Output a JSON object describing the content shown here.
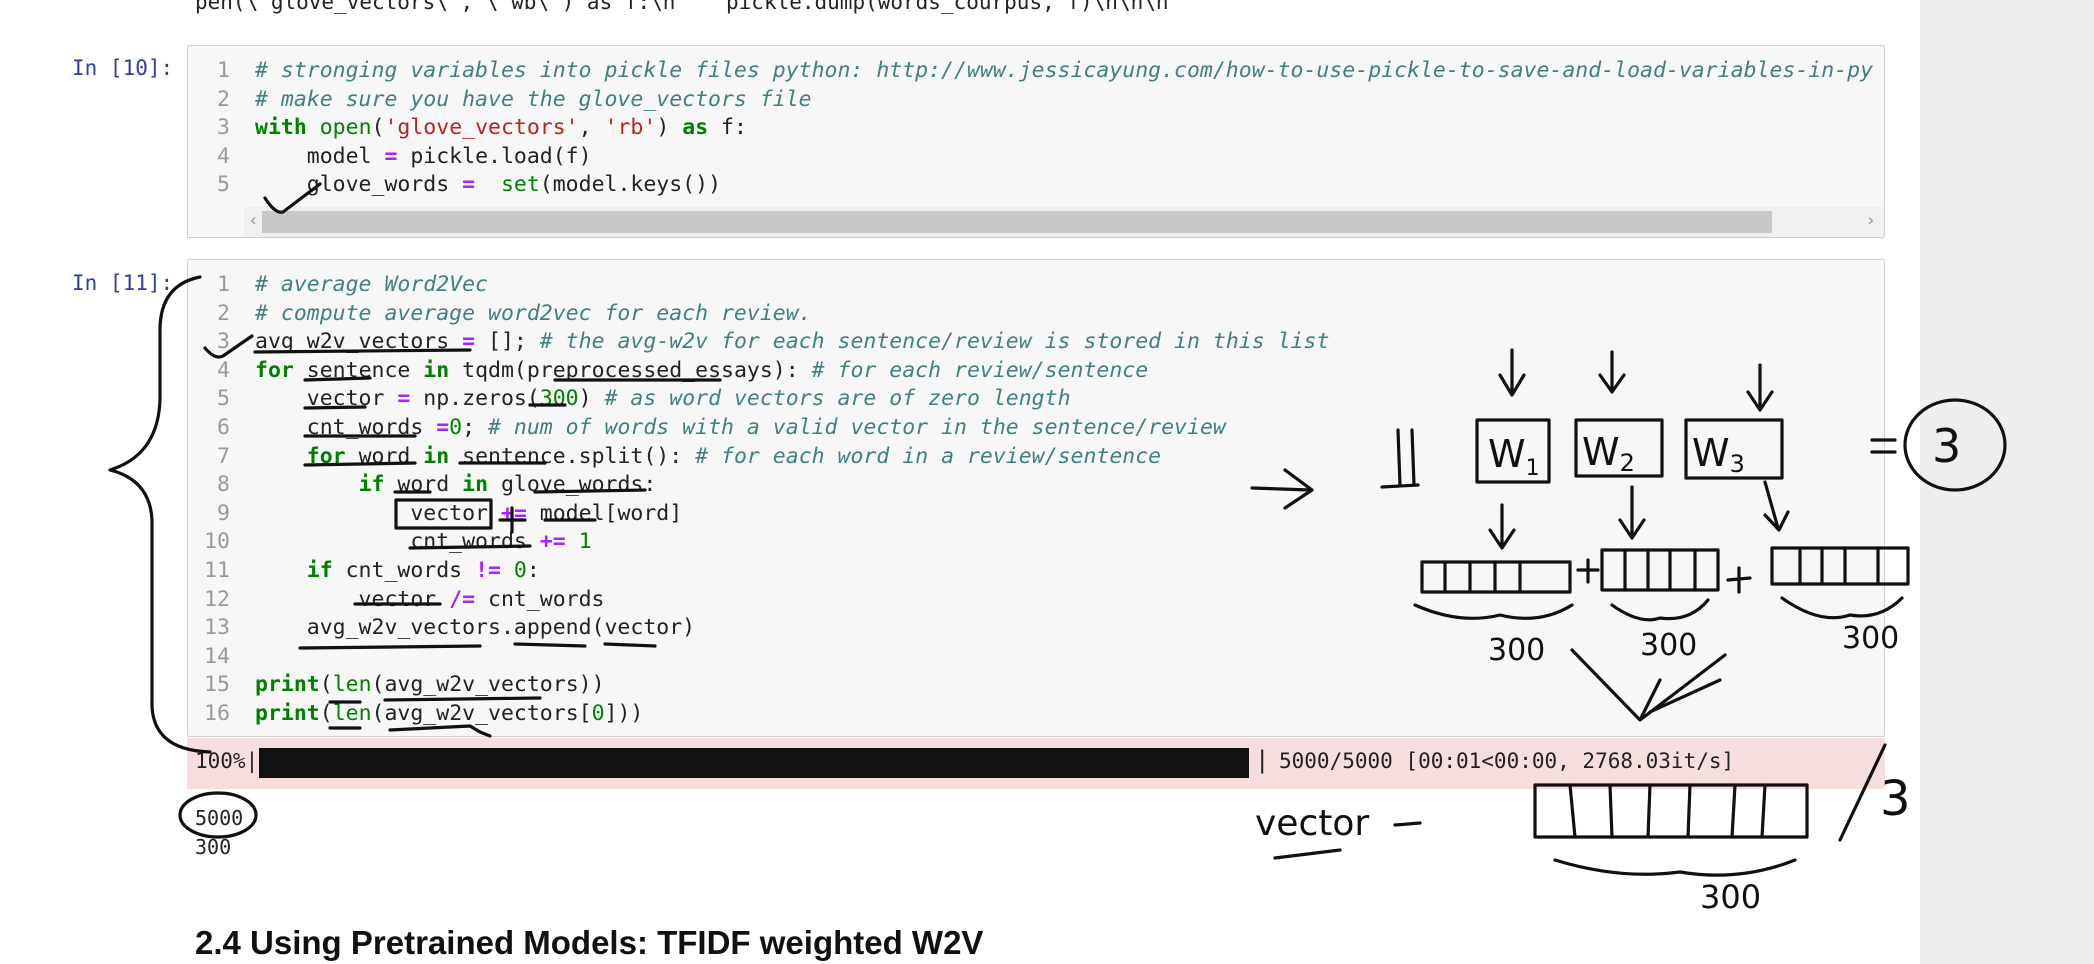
{
  "top_fragment": "pen(\\'glove_vectors\\', \\'wb\\') as f:\\n    pickle.dump(words_courpus, f)\\n\\n\\n",
  "cells": [
    {
      "prompt": "In [10]:",
      "lines": [
        [
          [
            "cm",
            "# stronging variables into pickle files python: http://www.jessicayung.com/how-to-use-pickle-to-save-and-load-variables-in-py"
          ]
        ],
        [
          [
            "cm",
            "# make sure you have the glove_vectors file"
          ]
        ],
        [
          [
            "kw",
            "with"
          ],
          [
            "tx",
            " "
          ],
          [
            "bi",
            "open"
          ],
          [
            "tx",
            "("
          ],
          [
            "st",
            "'glove_vectors'"
          ],
          [
            "tx",
            ", "
          ],
          [
            "st",
            "'rb'"
          ],
          [
            "tx",
            ") "
          ],
          [
            "kw",
            "as"
          ],
          [
            "tx",
            " f:"
          ]
        ],
        [
          [
            "tx",
            "    model "
          ],
          [
            "op",
            "="
          ],
          [
            "tx",
            " pickle.load(f)"
          ]
        ],
        [
          [
            "tx",
            "    glove_words "
          ],
          [
            "op",
            "="
          ],
          [
            "tx",
            "  "
          ],
          [
            "bi",
            "set"
          ],
          [
            "tx",
            "(model.keys())"
          ]
        ]
      ]
    },
    {
      "prompt": "In [11]:",
      "lines": [
        [
          [
            "cm",
            "# average Word2Vec"
          ]
        ],
        [
          [
            "cm",
            "# compute average word2vec for each review."
          ]
        ],
        [
          [
            "tx",
            "avg_w2v_vectors "
          ],
          [
            "op",
            "="
          ],
          [
            "tx",
            " []; "
          ],
          [
            "cm",
            "# the avg-w2v for each sentence/review is stored in this list"
          ]
        ],
        [
          [
            "kw",
            "for"
          ],
          [
            "tx",
            " sentence "
          ],
          [
            "kw",
            "in"
          ],
          [
            "tx",
            " tqdm(preprocessed_essays): "
          ],
          [
            "cm",
            "# for each review/sentence"
          ]
        ],
        [
          [
            "tx",
            "    vector "
          ],
          [
            "op",
            "="
          ],
          [
            "tx",
            " np.zeros("
          ],
          [
            "nm",
            "300"
          ],
          [
            "tx",
            ") "
          ],
          [
            "cm",
            "# as word vectors are of zero length"
          ]
        ],
        [
          [
            "tx",
            "    cnt_words "
          ],
          [
            "op",
            "="
          ],
          [
            "nm",
            "0"
          ],
          [
            "tx",
            "; "
          ],
          [
            "cm",
            "# num of words with a valid vector in the sentence/review"
          ]
        ],
        [
          [
            "tx",
            "    "
          ],
          [
            "kw",
            "for"
          ],
          [
            "tx",
            " word "
          ],
          [
            "kw",
            "in"
          ],
          [
            "tx",
            " sentence.split(): "
          ],
          [
            "cm",
            "# for each word in a review/sentence"
          ]
        ],
        [
          [
            "tx",
            "        "
          ],
          [
            "kw",
            "if"
          ],
          [
            "tx",
            " word "
          ],
          [
            "kw",
            "in"
          ],
          [
            "tx",
            " glove_words:"
          ]
        ],
        [
          [
            "tx",
            "            vector "
          ],
          [
            "op",
            "+="
          ],
          [
            "tx",
            " model[word]"
          ]
        ],
        [
          [
            "tx",
            "            cnt_words "
          ],
          [
            "op",
            "+="
          ],
          [
            "tx",
            " "
          ],
          [
            "nm",
            "1"
          ]
        ],
        [
          [
            "tx",
            "    "
          ],
          [
            "kw",
            "if"
          ],
          [
            "tx",
            " cnt_words "
          ],
          [
            "op",
            "!="
          ],
          [
            "tx",
            " "
          ],
          [
            "nm",
            "0"
          ],
          [
            "tx",
            ":"
          ]
        ],
        [
          [
            "tx",
            "        vector "
          ],
          [
            "op",
            "/="
          ],
          [
            "tx",
            " cnt_words"
          ]
        ],
        [
          [
            "tx",
            "    avg_w2v_vectors.append(vector)"
          ]
        ],
        [
          [
            "tx",
            ""
          ]
        ],
        [
          [
            "kw",
            "print"
          ],
          [
            "tx",
            "("
          ],
          [
            "bi",
            "len"
          ],
          [
            "tx",
            "(avg_w2v_vectors))"
          ]
        ],
        [
          [
            "kw",
            "print"
          ],
          [
            "tx",
            "("
          ],
          [
            "bi",
            "len"
          ],
          [
            "tx",
            "(avg_w2v_vectors["
          ],
          [
            "nm",
            "0"
          ],
          [
            "tx",
            "]))"
          ]
        ]
      ]
    }
  ],
  "progress": {
    "percent_label": "100%|",
    "fraction_complete": 1.0,
    "separator": "|",
    "status": "5000/5000 [00:01<00:00, 2768.03it/s]"
  },
  "outputs": [
    "5000",
    "300"
  ],
  "next_heading": "2.4 Using Pretrained Models: TFIDF weighted W2V",
  "annotations": {
    "equals_three": "3",
    "w1": "W",
    "w1_sub": "1",
    "w2": "W",
    "w2_sub": "2",
    "w3": "W",
    "w3_sub": "3",
    "dim_label": "300",
    "vector_word": "vector",
    "divide_by": "3"
  }
}
